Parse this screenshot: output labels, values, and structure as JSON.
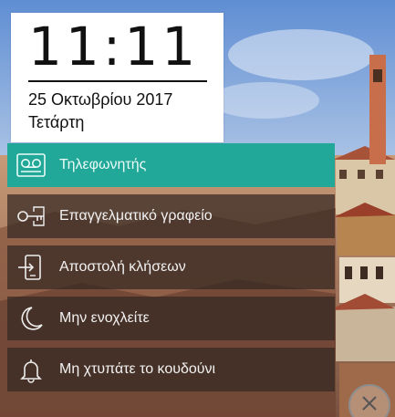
{
  "clock": {
    "time": "11:11",
    "date": "25 Οκτωβρίου 2017",
    "day": "Τετάρτη"
  },
  "menu": {
    "items": [
      {
        "label": "Τηλεφωνητής",
        "icon": "voicemail-icon",
        "active": true
      },
      {
        "label": "Επαγγελματικό γραφείο",
        "icon": "key-icon",
        "active": false
      },
      {
        "label": "Αποστολή κλήσεων",
        "icon": "call-forward-icon",
        "active": false
      },
      {
        "label": "Μην ενοχλείτε",
        "icon": "moon-icon",
        "active": false
      },
      {
        "label": "Μη χτυπάτε το κουδούνι",
        "icon": "bell-icon",
        "active": false
      }
    ]
  },
  "close_button": {
    "icon": "close-icon"
  },
  "colors": {
    "accent": "#22a898",
    "menu_background": "#342822",
    "card_background": "#ffffff"
  }
}
